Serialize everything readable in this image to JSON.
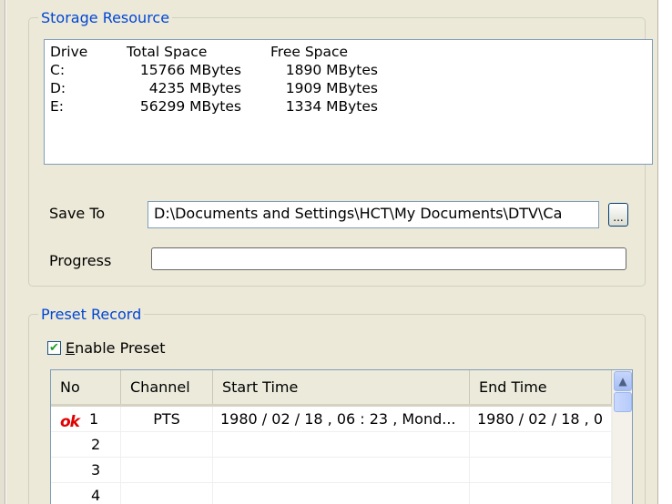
{
  "storage": {
    "legend": "Storage Resource",
    "headers": {
      "drive": "Drive",
      "total": "Total Space",
      "free": "Free Space"
    },
    "drives": [
      {
        "drive": "C:",
        "total": "15766 MBytes",
        "free": "1890 MBytes"
      },
      {
        "drive": "D:",
        "total": "4235 MBytes",
        "free": "1909 MBytes"
      },
      {
        "drive": "E:",
        "total": "56299 MBytes",
        "free": "1334 MBytes"
      }
    ],
    "save_to_label": "Save To",
    "save_to_value": "D:\\Documents and Settings\\HCT\\My Documents\\DTV\\Ca",
    "browse_label": "...",
    "progress_label": "Progress",
    "progress_value": 0
  },
  "preset": {
    "legend": "Preset Record",
    "enable_label_prefix": "E",
    "enable_label_rest": "nable Preset",
    "enabled": true,
    "columns": {
      "no": "No",
      "channel": "Channel",
      "start": "Start Time",
      "end": "End Time"
    },
    "rows": [
      {
        "status": "ok",
        "no": "1",
        "channel": "PTS",
        "start": "1980 / 02 / 18 , 06 : 23 , Mond...",
        "end": "1980 / 02 / 18 , 0"
      },
      {
        "status": "",
        "no": "2",
        "channel": "",
        "start": "",
        "end": ""
      },
      {
        "status": "",
        "no": "3",
        "channel": "",
        "start": "",
        "end": ""
      },
      {
        "status": "",
        "no": "4",
        "channel": "",
        "start": "",
        "end": ""
      }
    ]
  },
  "icons": {
    "check": "checkmark-icon",
    "status_ok": "ok-status-icon",
    "scroll_up": "scroll-up-arrow-icon"
  },
  "colors": {
    "legend_text": "#0046d5",
    "status_ok": "#e00000",
    "check": "#21a121",
    "panel_bg": "#ece9d8"
  }
}
